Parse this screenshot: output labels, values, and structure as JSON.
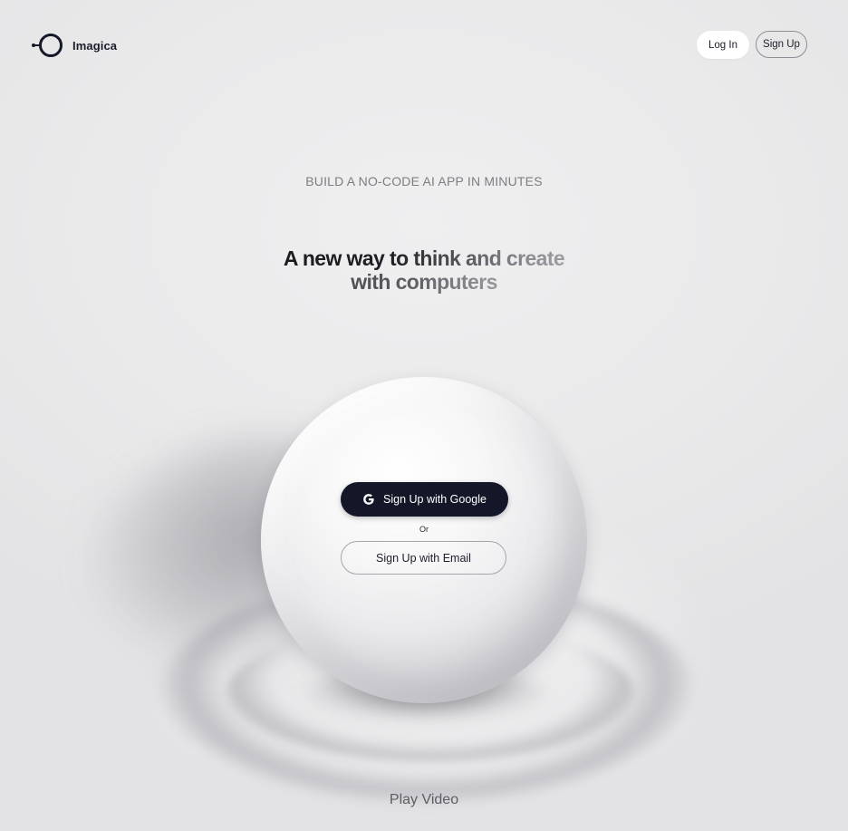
{
  "brand": {
    "name": "Imagica",
    "logo_icon": "imagica-logo-icon"
  },
  "header": {
    "login_label": "Log In",
    "signup_label": "Sign Up"
  },
  "hero": {
    "eyebrow": "BUILD A NO-CODE AI APP IN MINUTES",
    "headline_line1": "A new way to think and create",
    "headline_line2": "with computers"
  },
  "cta": {
    "google_label": "Sign Up with Google",
    "google_icon": "google-icon",
    "or_label": "Or",
    "email_label": "Sign Up with Email"
  },
  "footer": {
    "play_video_label": "Play Video"
  },
  "colors": {
    "background": "#e9e9ea",
    "primary_button": "#141727",
    "text_dark": "#1b1d2a",
    "text_muted": "#7d7d83"
  }
}
